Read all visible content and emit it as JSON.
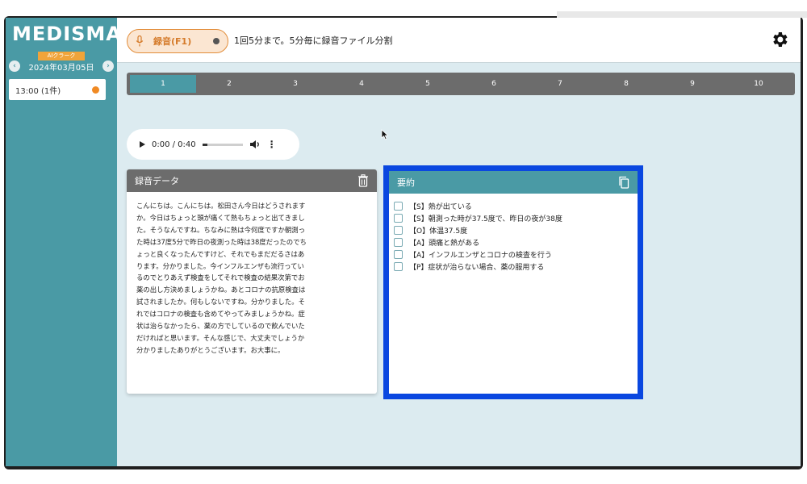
{
  "app": {
    "logo_text": "MEDISMA",
    "logo_badge": "AIクラーク",
    "accent_color": "#4a9aa5",
    "record_color": "#e28d3a",
    "highlight_color": "#0a47e0"
  },
  "sidebar": {
    "date": "2024年03月05日",
    "prev_icon": "chevron-left-icon",
    "next_icon": "chevron-right-icon",
    "sessions": [
      {
        "label": "13:00 (1件)",
        "status_color": "#f08a24"
      }
    ]
  },
  "header": {
    "record_button_label": "録音(F1)",
    "record_note": "1回5分まで。5分毎に録音ファイル分割",
    "settings_icon": "gear-icon"
  },
  "tabs": [
    "1",
    "2",
    "3",
    "4",
    "5",
    "6",
    "7",
    "8",
    "9",
    "10"
  ],
  "active_tab": 0,
  "audio": {
    "time": "0:00 / 0:40",
    "progress": 0.0
  },
  "recording_panel": {
    "title": "録音データ",
    "lines": [
      "こんにちは。こんにちは。松田さん今日はどうされます",
      "か。今日はちょっと頭が痛くて熱もちょっと出てきまし",
      "た。そうなんですね。ちなみに熱は今何度ですか朝測っ",
      "た時は37度5分で昨日の夜測った時は38度だったのでち",
      "ょっと良くなったんですけど、それでもまだだるさはあ",
      "ります。分かりました。今インフルエンザも流行ってい",
      "るのでとりあえず検査をしてそれで検査の結果次第でお",
      "薬の出し方決めましょうかね。あとコロナの抗原検査は",
      "試されましたか。何もしないですね。分かりました。そ",
      "れではコロナの検査も含めてやってみましょうかね。症",
      "状は治らなかったら、薬の方でしているので飲んでいた",
      "だければと思います。そんな感じで、大丈夫でしょうか",
      "分かりましたありがとうございます。お大事に。"
    ]
  },
  "summary_panel": {
    "title": "要約",
    "items": [
      "【S】熱が出ている",
      "【S】朝測った時が37.5度で、昨日の夜が38度",
      "【O】体温37.5度",
      "【A】頭痛と熱がある",
      "【A】インフルエンザとコロナの検査を行う",
      "【P】症状が治らない場合、薬の服用する"
    ]
  }
}
